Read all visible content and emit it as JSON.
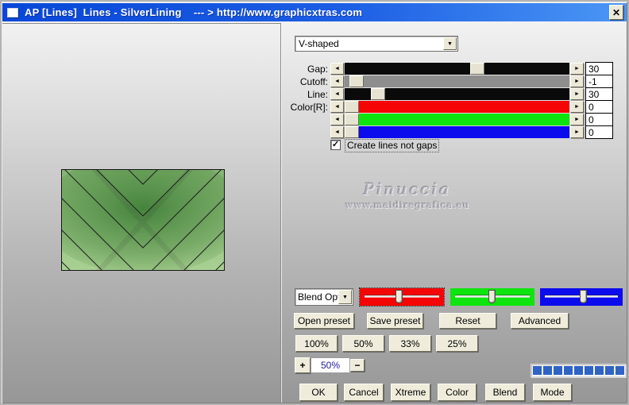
{
  "window": {
    "title": "AP [Lines]  Lines - SilverLining    --- > http://www.graphicxtras.com"
  },
  "icons": {
    "close": "✕",
    "dropdown_arrow": "▼",
    "slider_left": "◄",
    "slider_right": "►",
    "check": "✓"
  },
  "preset_dropdown": {
    "value": "V-shaped"
  },
  "sliders": {
    "rows": [
      {
        "label": "Gap:",
        "value": "30",
        "track_color": "#0a0a0a"
      },
      {
        "label": "Cutoff:",
        "value": "-1",
        "track_color": "#8e8e8e"
      },
      {
        "label": "Line:",
        "value": "30",
        "track_color": "#0a0a0a"
      },
      {
        "label": "Color[R]:",
        "value": "0",
        "track_color": "#f50505"
      },
      {
        "label": "",
        "value": "0",
        "track_color": "#0ee40e"
      },
      {
        "label": "",
        "value": "0",
        "track_color": "#0b0bee"
      }
    ]
  },
  "checkbox": {
    "label": "Create lines not gaps",
    "checked": true
  },
  "watermark": {
    "name": "Pinuccia",
    "site": "www.maidiregrafica.eu"
  },
  "blend_options": {
    "dropdown_value": "Blend Opti",
    "channel_colors": [
      "#f50505",
      "#0ee40e",
      "#0b0bee"
    ]
  },
  "preset_buttons": {
    "open": "Open preset",
    "save": "Save preset",
    "reset": "Reset",
    "advanced": "Advanced"
  },
  "zoom_buttons": {
    "b100": "100%",
    "b50": "50%",
    "b33": "33%",
    "b25": "25%"
  },
  "zoom_stepper": {
    "plus": "+",
    "value": "50%",
    "minus": "−"
  },
  "progress": {
    "segments": 9,
    "color": "#2f63c6"
  },
  "action_buttons": {
    "ok": "OK",
    "cancel": "Cancel",
    "xtreme": "Xtreme",
    "color": "Color",
    "blend": "Blend",
    "mode": "Mode"
  }
}
